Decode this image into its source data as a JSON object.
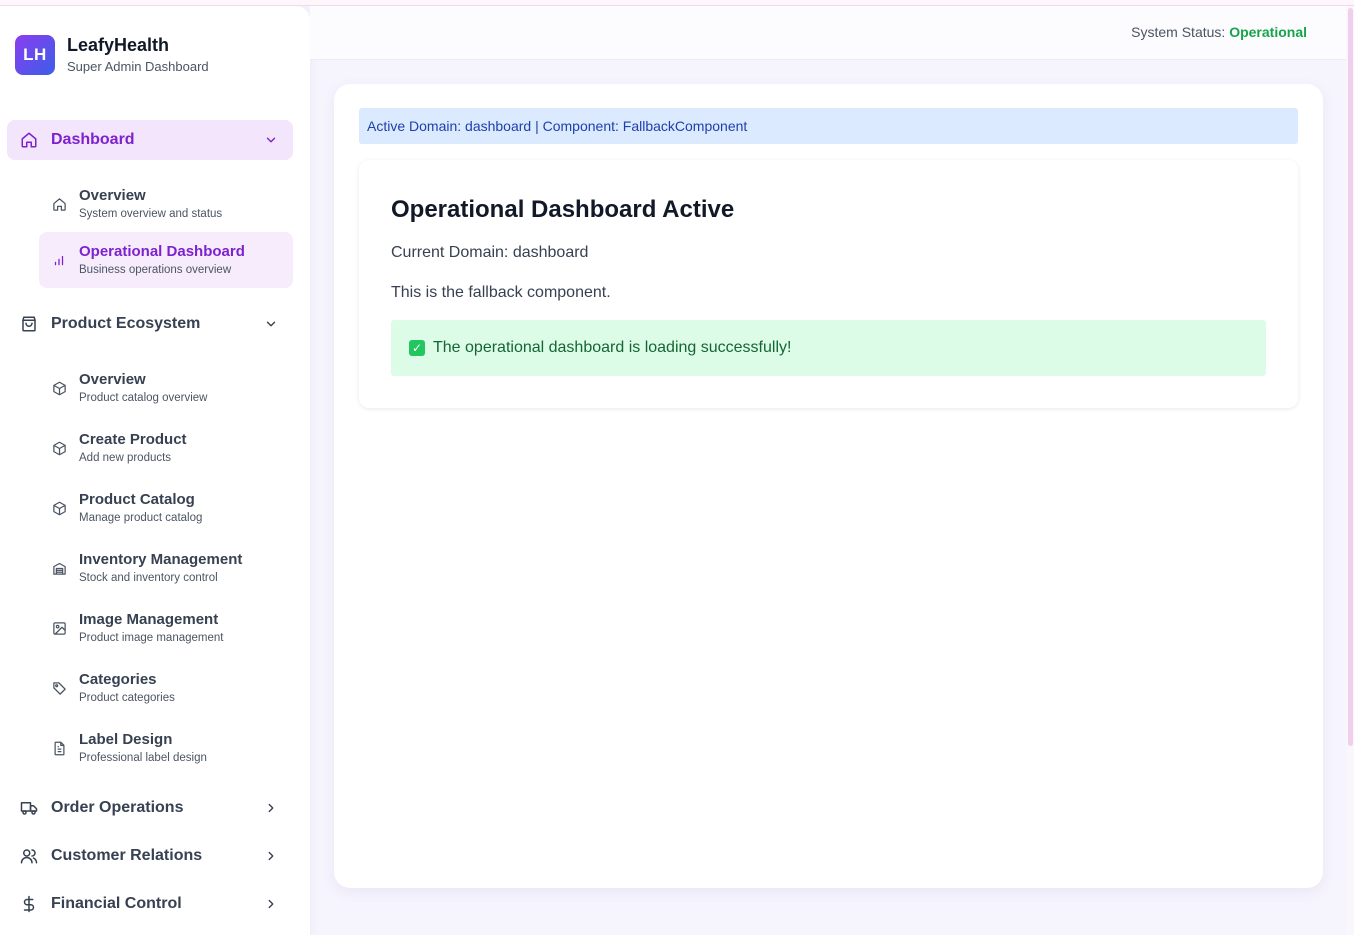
{
  "brand": {
    "logo_text": "LH",
    "name": "LeafyHealth",
    "subtitle": "Super Admin Dashboard"
  },
  "sidebar": {
    "groups": [
      {
        "label": "Dashboard",
        "icon": "home-icon",
        "expanded": true,
        "active": true,
        "items": [
          {
            "label": "Overview",
            "desc": "System overview and status",
            "icon": "home-icon"
          },
          {
            "label": "Operational Dashboard",
            "desc": "Business operations overview",
            "icon": "bar-chart-icon",
            "active": true
          }
        ]
      },
      {
        "label": "Product Ecosystem",
        "icon": "shopping-bag-icon",
        "expanded": true,
        "items": [
          {
            "label": "Overview",
            "desc": "Product catalog overview",
            "icon": "package-icon"
          },
          {
            "label": "Create Product",
            "desc": "Add new products",
            "icon": "package-icon"
          },
          {
            "label": "Product Catalog",
            "desc": "Manage product catalog",
            "icon": "package-icon"
          },
          {
            "label": "Inventory Management",
            "desc": "Stock and inventory control",
            "icon": "warehouse-icon"
          },
          {
            "label": "Image Management",
            "desc": "Product image management",
            "icon": "image-icon"
          },
          {
            "label": "Categories",
            "desc": "Product categories",
            "icon": "tag-icon"
          },
          {
            "label": "Label Design",
            "desc": "Professional label design",
            "icon": "file-text-icon"
          }
        ]
      },
      {
        "label": "Order Operations",
        "icon": "truck-icon",
        "expanded": false
      },
      {
        "label": "Customer Relations",
        "icon": "users-icon",
        "expanded": false
      },
      {
        "label": "Financial Control",
        "icon": "dollar-icon",
        "expanded": false
      }
    ]
  },
  "header": {
    "status_label": "System Status:",
    "status_value": "Operational"
  },
  "main": {
    "debug_text": "Active Domain: dashboard | Component: FallbackComponent",
    "card": {
      "title": "Operational Dashboard Active",
      "domain_line": "Current Domain: dashboard",
      "fallback_line": "This is the fallback component.",
      "success_message": "The operational dashboard is loading successfully!"
    }
  },
  "colors": {
    "accent": "#7e22ce",
    "active_bg": "#f3e5fb",
    "status_ok": "#16a34a",
    "debug_bg": "#dbeafe",
    "success_bg": "#dcfce7"
  }
}
